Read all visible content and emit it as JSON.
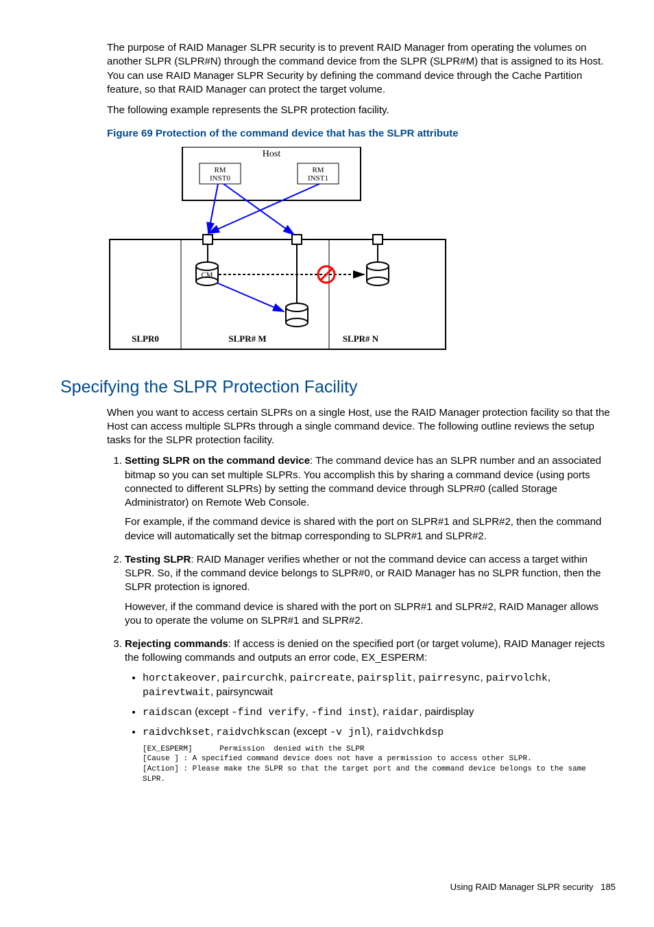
{
  "para1": "The purpose of RAID Manager SLPR security is to prevent RAID Manager from operating the volumes on another SLPR (SLPR#N) through the command device from the SLPR (SLPR#M) that is assigned to its Host. You can use RAID Manager SLPR Security by defining the command device through the Cache Partition feature, so that RAID Manager can protect the target volume.",
  "para2": "The following example represents the SLPR protection facility.",
  "figcap": "Figure 69 Protection of the command device that has the SLPR attribute",
  "diagram": {
    "host": "Host",
    "rm0": "RM\nINST0",
    "rm1": "RM\nINST1",
    "cm": "CM",
    "slpr0": "SLPR0",
    "slprm": "SLPR# M",
    "slprn": "SLPR# N"
  },
  "h2": "Specifying the SLPR Protection Facility",
  "intro": "When you want to access certain SLPRs on a single Host, use the RAID Manager protection facility so that the Host can access multiple SLPRs through a single command device. The following outline reviews the setup tasks for the SLPR protection facility.",
  "li1": {
    "bold": "Setting SLPR on the command device",
    "rest": ": The command device has an SLPR number and an associated bitmap so you can set multiple SLPRs. You accomplish this by sharing a command device (using ports connected to different SLPRs) by setting the command device through SLPR#0 (called Storage Administrator) on Remote Web Console.",
    "p2": "For example, if the command device is shared with the port on SLPR#1 and SLPR#2, then the command device will automatically set the bitmap corresponding to SLPR#1 and SLPR#2."
  },
  "li2": {
    "bold": "Testing SLPR",
    "rest": ": RAID Manager verifies whether or not the command device can access a target within SLPR. So, if the command device belongs to SLPR#0, or RAID Manager has no SLPR function, then the SLPR protection is ignored.",
    "p2": "However, if the command device is shared with the port on SLPR#1 and SLPR#2, RAID Manager allows you to operate the volume on SLPR#1 and SLPR#2."
  },
  "li3": {
    "bold": "Rejecting commands",
    "rest": ": If access is denied on the specified port (or target volume), RAID Manager rejects the following commands and outputs an error code, EX_ESPERM:",
    "b1a": "horctakeover",
    "b1b": "paircurchk",
    "b1c": "paircreate",
    "b1d": "pairsplit",
    "b1e": "pairresync",
    "b1f": "pairvolchk",
    "b1g": "pairevtwait",
    "b1h": "pairsyncwait",
    "b2a": "raidscan",
    "b2txt1": " (except ",
    "b2b": "-find verify",
    "b2c": "-find inst",
    "b2txt2": "), ",
    "b2d": "raidar",
    "b2e": "pairdisplay",
    "b3a": "raidvchkset",
    "b3b": "raidvchkscan",
    "b3txt1": " (except ",
    "b3c": "-v jnl",
    "b3txt2": "), ",
    "b3d": "raidvchkdsp",
    "pre": "[EX_ESPERM]      Permission  denied with the SLPR\n[Cause ] : A specified command device does not have a permission to access other SLPR.\n[Action] : Please make the SLPR so that the target port and the command device belongs to the same\nSLPR."
  },
  "footer_text": "Using RAID Manager SLPR security",
  "footer_num": "185"
}
